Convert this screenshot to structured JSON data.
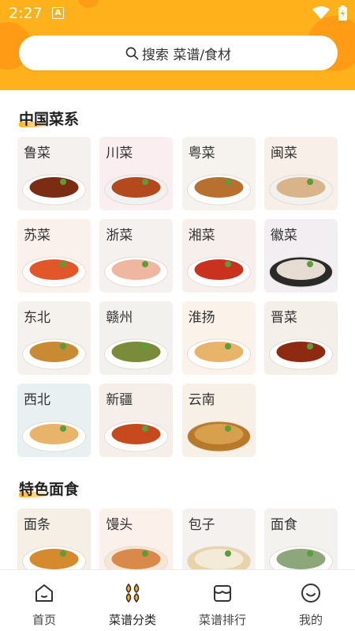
{
  "status": {
    "time": "2:27",
    "a_badge": "A"
  },
  "search": {
    "placeholder": "搜索 菜谱/食材"
  },
  "sections": [
    {
      "title": "中国菜系",
      "items": [
        {
          "label": "鲁菜",
          "bg": "#f4f1ee",
          "dish": "#7a2d12",
          "plate": "#ffffff"
        },
        {
          "label": "川菜",
          "bg": "#fbeef1",
          "dish": "#b24a1e",
          "plate": "#f1f1f1"
        },
        {
          "label": "粤菜",
          "bg": "#f6f3ee",
          "dish": "#b7702e",
          "plate": "#ffffff"
        },
        {
          "label": "闽菜",
          "bg": "#f7efe8",
          "dish": "#d9b48a",
          "plate": "#f3f1ee"
        },
        {
          "label": "苏菜",
          "bg": "#fbf1ec",
          "dish": "#e2572a",
          "plate": "#ffffff"
        },
        {
          "label": "浙菜",
          "bg": "#f4f1ef",
          "dish": "#f0b7a0",
          "plate": "#ffffff"
        },
        {
          "label": "湘菜",
          "bg": "#f7efec",
          "dish": "#c8321e",
          "plate": "#ffffff"
        },
        {
          "label": "徽菜",
          "bg": "#f3eef2",
          "dish": "#e6dcd2",
          "plate": "#2a2a2a"
        },
        {
          "label": "东北",
          "bg": "#f5f2ee",
          "dish": "#c98a34",
          "plate": "#ffffff"
        },
        {
          "label": "赣州",
          "bg": "#f3f1ee",
          "dish": "#7a8b3a",
          "plate": "#ffffff"
        },
        {
          "label": "淮扬",
          "bg": "#fbf2ea",
          "dish": "#e7b46a",
          "plate": "#ffffff"
        },
        {
          "label": "晋菜",
          "bg": "#f5efea",
          "dish": "#8e2a12",
          "plate": "#ffffff"
        },
        {
          "label": "西北",
          "bg": "#e8f0f1",
          "dish": "#e8b36b",
          "plate": "#ffffff"
        },
        {
          "label": "新疆",
          "bg": "#f6efe9",
          "dish": "#c64a1e",
          "plate": "#ffffff"
        },
        {
          "label": "云南",
          "bg": "#f6f0e6",
          "dish": "#d7a04c",
          "plate": "#b77a2b"
        }
      ]
    },
    {
      "title": "特色面食",
      "items": [
        {
          "label": "面条",
          "bg": "#f6efe6",
          "dish": "#d68a2e",
          "plate": "#ffffff"
        },
        {
          "label": "馒头",
          "bg": "#fbf1ea",
          "dish": "#d98a4a",
          "plate": "#f6e6d6"
        },
        {
          "label": "包子",
          "bg": "#f4f1ee",
          "dish": "#f3ead8",
          "plate": "#e8d2a8"
        },
        {
          "label": "面食",
          "bg": "#f3f2ef",
          "dish": "#8da77a",
          "plate": "#ffffff"
        }
      ]
    }
  ],
  "bottom_nav": [
    {
      "label": "首页",
      "icon": "home-icon",
      "active": false
    },
    {
      "label": "菜谱分类",
      "icon": "category-icon",
      "active": true
    },
    {
      "label": "菜谱排行",
      "icon": "ranking-icon",
      "active": false
    },
    {
      "label": "我的",
      "icon": "profile-icon",
      "active": false
    }
  ],
  "colors": {
    "accent": "#ffb11b",
    "accent_dark": "#ff9b14"
  }
}
